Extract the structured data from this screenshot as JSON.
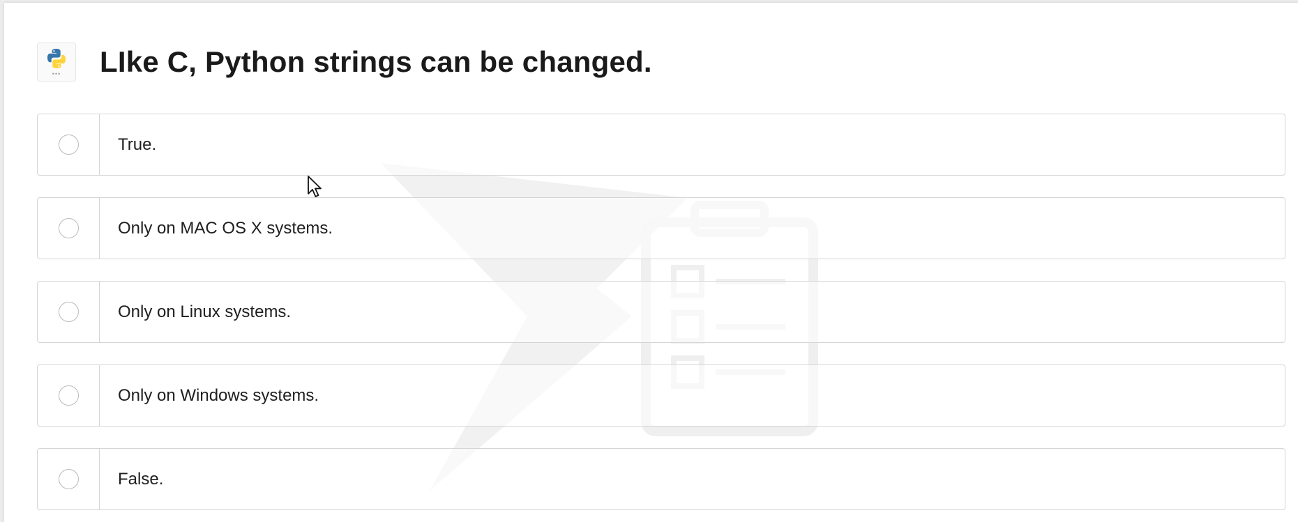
{
  "question": {
    "logo_icon": "python-logo-icon",
    "text": "LIke C, Python strings can be changed."
  },
  "options": [
    {
      "label": "True."
    },
    {
      "label": "Only on MAC OS X systems."
    },
    {
      "label": "Only on Linux systems."
    },
    {
      "label": "Only on Windows systems."
    },
    {
      "label": "False."
    }
  ],
  "colors": {
    "python_blue": "#3776AB",
    "python_yellow": "#FFD43B",
    "border": "#d3d5d8",
    "text": "#1a1a1a"
  }
}
